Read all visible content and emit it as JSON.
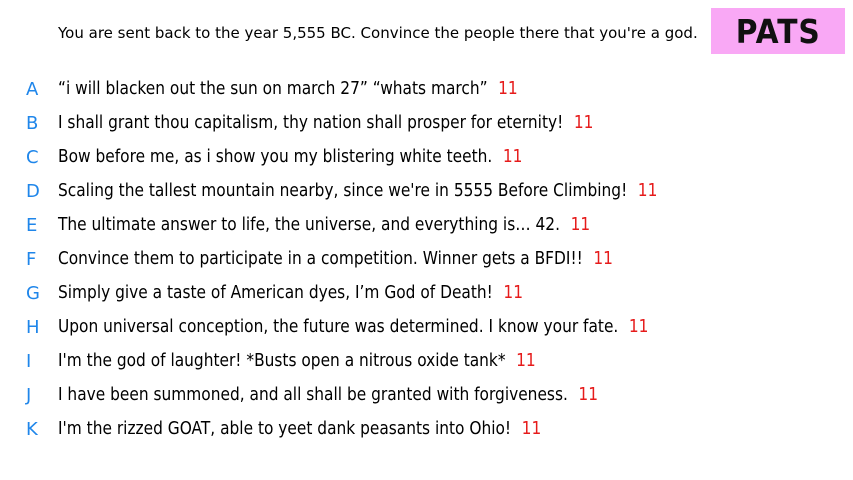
{
  "prompt": "You are sent back to the year 5,555 BC. Convince the people there that you're a god.",
  "badge": "PATS",
  "colors": {
    "letter": "#1f86ea",
    "score": "#e61b1b",
    "badge_bg": "#f9a8f5"
  },
  "entries": [
    {
      "letter": "A",
      "text": "“i will blacken out the sun on march 27” “whats march”",
      "score": "11"
    },
    {
      "letter": "B",
      "text": "I shall grant thou capitalism, thy nation shall prosper for eternity!",
      "score": "11"
    },
    {
      "letter": "C",
      "text": "Bow before me, as i show you my blistering white teeth.",
      "score": "11"
    },
    {
      "letter": "D",
      "text": "Scaling the tallest mountain nearby, since we're in 5555 Before Climbing!",
      "score": "11"
    },
    {
      "letter": "E",
      "text": "The ultimate answer to life, the universe, and everything is… 42.",
      "score": "11"
    },
    {
      "letter": "F",
      "text": "Convince them to participate in a competition. Winner gets a BFDI!!",
      "score": "11"
    },
    {
      "letter": "G",
      "text": "Simply give a taste of American dyes, I’m God of Death!",
      "score": "11"
    },
    {
      "letter": "H",
      "text": "Upon universal conception, the future was determined. I know your fate.",
      "score": "11"
    },
    {
      "letter": "I",
      "text": "I'm the god of laughter! *Busts open a nitrous oxide tank*",
      "score": "11"
    },
    {
      "letter": "J",
      "text": "I have been summoned, and all shall be granted with forgiveness.",
      "score": "11"
    },
    {
      "letter": "K",
      "text": "I'm the rizzed GOAT, able to yeet dank peasants into Ohio!",
      "score": "11"
    }
  ]
}
